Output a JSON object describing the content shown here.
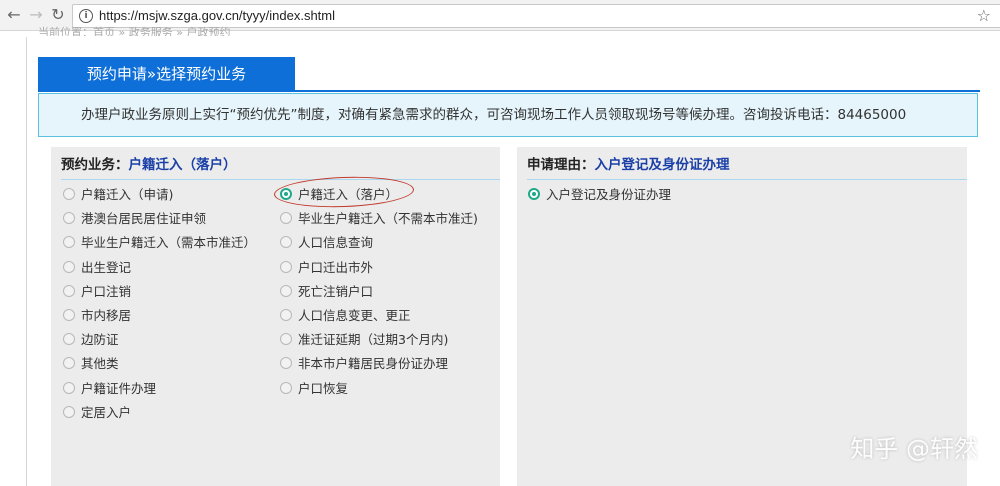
{
  "browser": {
    "url": "https://msjw.szga.gov.cn/tyyy/index.shtml"
  },
  "breadcrumb": "当前位置：首页 » 政务服务 » 户政预约",
  "tab": {
    "label": "预约申请»选择预约业务"
  },
  "notice": "办理户政业务原则上实行“预约优先”制度，对确有紧急需求的群众，可咨询现场工作人员领取现场号等候办理。咨询投诉电话：84465000",
  "left_panel": {
    "head_label": "预约业务：",
    "head_value": "户籍迁入（落户）",
    "col1": [
      "户籍迁入（申请)",
      "港澳台居民居住证申领",
      "毕业生户籍迁入（需本市准迁）",
      "出生登记",
      "户口注销",
      "市内移居",
      "边防证",
      "其他类",
      "户籍证件办理",
      "定居入户"
    ],
    "col2": [
      "户籍迁入（落户）",
      "毕业生户籍迁入（不需本市准迁)",
      "人口信息查询",
      "户口迁出市外",
      "死亡注销户口",
      "人口信息变更、更正",
      "准迁证延期（过期3个月内)",
      "非本市户籍居民身份证办理",
      "户口恢复"
    ],
    "selected": "户籍迁入（落户）"
  },
  "right_panel": {
    "head_label": "申请理由：",
    "head_value": "入户登记及身份证办理",
    "options": [
      "入户登记及身份证办理"
    ],
    "selected": "入户登记及身份证办理"
  },
  "watermark": "知乎 @轩然",
  "colors": {
    "tab_blue": "#0e6fd8",
    "accent_green": "#1fa98a",
    "highlight_blue": "#1a3fa7",
    "annotation_red": "#c0392b"
  }
}
